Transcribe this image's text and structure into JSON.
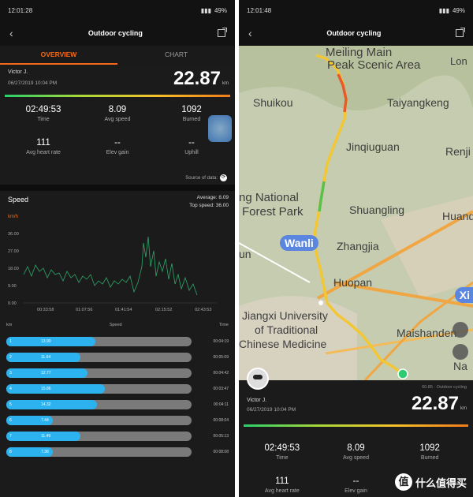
{
  "left": {
    "status": {
      "time": "12:01:28",
      "battery": "49%"
    },
    "title": "Outdoor cycling",
    "tabs": [
      "OVERVIEW",
      "CHART"
    ],
    "user": {
      "name": "Victor J.",
      "date": "06/27/2019 10:04 PM"
    },
    "distance": {
      "value": "22.87",
      "unit": "km"
    },
    "stats": [
      {
        "value": "02:49:53",
        "label": "Time"
      },
      {
        "value": "8.09",
        "label": "Avg speed"
      },
      {
        "value": "1092",
        "label": "Burned"
      },
      {
        "value": "111",
        "label": "Avg heart rate"
      },
      {
        "value": "--",
        "label": "Elev gain"
      },
      {
        "value": "--",
        "label": "Uphill"
      }
    ],
    "source": "Source of data:",
    "speed": {
      "title": "Speed",
      "average": "Average: 8.09",
      "top": "Top speed: 36.00",
      "unit": "km/h",
      "y_ticks": [
        "36.00",
        "27.00",
        "18.00",
        "9.00",
        "0.00"
      ],
      "x_ticks": [
        "00:33:58",
        "01:07:56",
        "01:41:54",
        "02:15:52",
        "02:43:53"
      ]
    },
    "splits_header": {
      "col1": "km",
      "col2": "Speed",
      "col3": "Time"
    },
    "splits": [
      {
        "idx": "1",
        "speed": "13.90",
        "pct": 0.48,
        "time": "00:04:19"
      },
      {
        "idx": "2",
        "speed": "11.64",
        "pct": 0.4,
        "time": "00:05:09"
      },
      {
        "idx": "3",
        "speed": "12.77",
        "pct": 0.44,
        "time": "00:04:42"
      },
      {
        "idx": "4",
        "speed": "15.86",
        "pct": 0.53,
        "time": "00:03:47"
      },
      {
        "idx": "5",
        "speed": "14.32",
        "pct": 0.49,
        "time": "00:04:11"
      },
      {
        "idx": "6",
        "speed": "7.44",
        "pct": 0.25,
        "time": "00:08:04"
      },
      {
        "idx": "7",
        "speed": "11.49",
        "pct": 0.4,
        "time": "00:05:13"
      },
      {
        "idx": "8",
        "speed": "7.38",
        "pct": 0.25,
        "time": "00:08:08"
      }
    ]
  },
  "right": {
    "status": {
      "time": "12:01:48",
      "battery": "49%"
    },
    "title": "Outdoor cycling",
    "map_labels": {
      "meiling": "Meiling Main",
      "peak": "Peak Scenic Area",
      "lon": "Lon",
      "shuikou": "Shuikou",
      "taiyang": "Taiyangkeng",
      "jinqiu": "Jinqiuguan",
      "renji": "Renji",
      "national": "ng National",
      "forest": "Forest Park",
      "shuangling": "Shuangling",
      "huanq": "Huanq",
      "wanli": "Wanli",
      "zhangjia": "Zhangjia",
      "un": "un",
      "huopan": "Huopan",
      "xi": "Xi",
      "jiangxi": "Jiangxi University",
      "traditional": "of Traditional",
      "chinese": "Chinese Medicine",
      "maishan": "Maishanden",
      "na": "Na"
    },
    "user": {
      "name": "Victor J.",
      "date": "06/27/2019 10:04 PM"
    },
    "source": "60.85 · Outdoor cycling",
    "distance": {
      "value": "22.87",
      "unit": "km"
    },
    "stats": [
      {
        "value": "02:49:53",
        "label": "Time"
      },
      {
        "value": "8.09",
        "label": "Avg speed"
      },
      {
        "value": "1092",
        "label": "Burned"
      },
      {
        "value": "111",
        "label": "Avg heart rate"
      },
      {
        "value": "--",
        "label": "Elev gain"
      }
    ],
    "watermark": "什么值得买"
  }
}
